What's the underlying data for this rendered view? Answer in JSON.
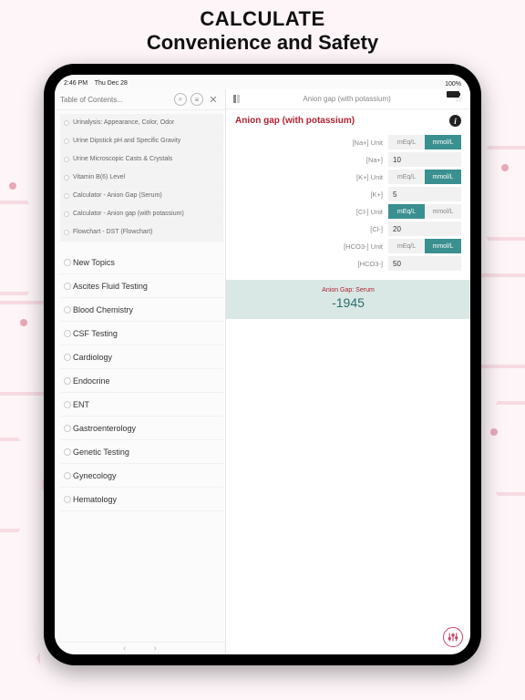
{
  "headline": {
    "line1": "CALCULATE",
    "line2": "Convenience and Safety"
  },
  "statusbar": {
    "time": "2:46 PM",
    "date": "Thu Dec 28",
    "battery": "100%"
  },
  "leftPane": {
    "title": "Table of Contents...",
    "subItems": [
      "Urinalysis: Appearance, Color, Odor",
      "Urine Dipstick pH and Specific Gravity",
      "Urine Microscopic Casts & Crystals",
      "Vitamin B(6) Level",
      "Calculator - Anion Gap (Serum)",
      "Calculator - Anion gap (with potassium)",
      "Flowchart - DST (Flowchart)"
    ],
    "categories": [
      "New Topics",
      "Ascites Fluid Testing",
      "Blood Chemistry",
      "CSF Testing",
      "Cardiology",
      "Endocrine",
      "ENT",
      "Gastroenterology",
      "Genetic Testing",
      "Gynecology",
      "Hematology"
    ]
  },
  "rightPane": {
    "headerTitle": "Anion gap (with potassium)",
    "calcTitle": "Anion gap (with potassium)",
    "units": {
      "opt1": "mEq/L",
      "opt2": "mmol/L"
    },
    "rows": [
      {
        "label": "[Na+] Unit",
        "type": "seg",
        "sel": 1
      },
      {
        "label": "[Na+]",
        "type": "val",
        "value": "10"
      },
      {
        "label": "[K+] Unit",
        "type": "seg",
        "sel": 1
      },
      {
        "label": "[K+]",
        "type": "val",
        "value": "5"
      },
      {
        "label": "[Cl-] Unit",
        "type": "seg",
        "sel": 0
      },
      {
        "label": "[Cl-]",
        "type": "val",
        "value": "20"
      },
      {
        "label": "[HCO3-] Unit",
        "type": "seg",
        "sel": 1
      },
      {
        "label": "[HCO3-]",
        "type": "val",
        "value": "50"
      }
    ],
    "result": {
      "label": "Anion Gap: Serum",
      "value": "-1945"
    }
  }
}
